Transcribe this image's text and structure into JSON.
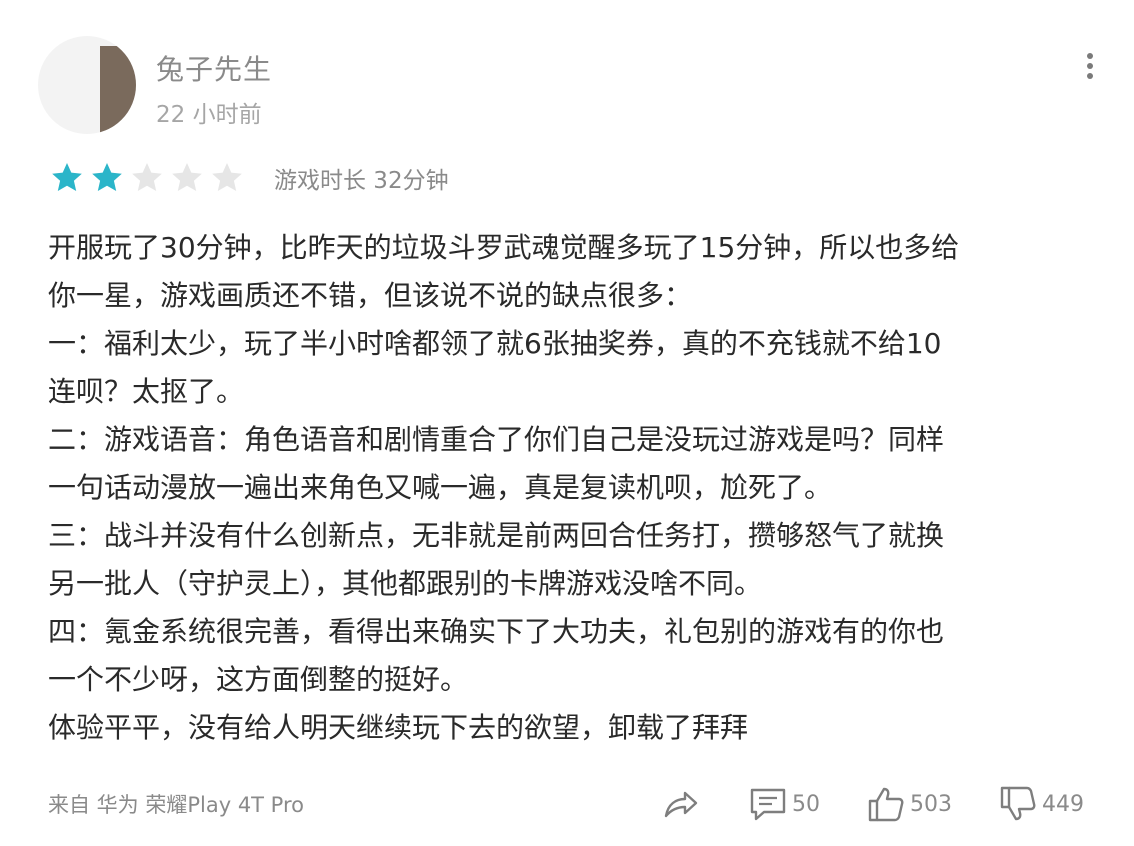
{
  "user": {
    "name": "兔子先生",
    "time": "22 小时前"
  },
  "rating": {
    "stars_filled": 2,
    "stars_total": 5,
    "playtime": "游戏时长 32分钟"
  },
  "review": {
    "lines": [
      "开服玩了30分钟，比昨天的垃圾斗罗武魂觉醒多玩了15分钟，所以也多给",
      "你一星，游戏画质还不错，但该说不说的缺点很多：",
      "一：福利太少，玩了半小时啥都领了就6张抽奖券，真的不充钱就不给10",
      "连呗？太抠了。",
      "二：游戏语音：角色语音和剧情重合了你们自己是没玩过游戏是吗？同样",
      "一句话动漫放一遍出来角色又喊一遍，真是复读机呗，尬死了。",
      "三：战斗并没有什么创新点，无非就是前两回合任务打，攒够怒气了就换",
      "另一批人（守护灵上），其他都跟别的卡牌游戏没啥不同。",
      "四：氪金系统很完善，看得出来确实下了大功夫，礼包别的游戏有的你也",
      "一个不少呀，这方面倒整的挺好。",
      "体验平平，没有给人明天继续玩下去的欲望，卸载了拜拜"
    ]
  },
  "footer": {
    "device": "来自 华为 荣耀Play 4T Pro",
    "comments": "50",
    "likes": "503",
    "dislikes": "449"
  },
  "colors": {
    "star_filled": "#2bb5c9",
    "star_empty": "#e6e6e6",
    "icon_gray": "#8a8a8a"
  },
  "icons": {
    "share": "share-arrow-icon",
    "comment": "comment-icon",
    "like": "thumbs-up-icon",
    "dislike": "thumbs-down-icon",
    "more": "more-vertical-icon"
  }
}
